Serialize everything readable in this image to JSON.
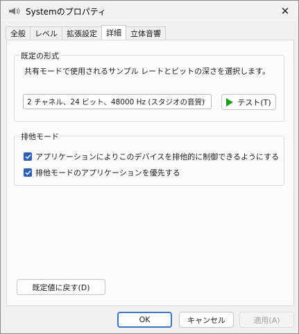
{
  "window": {
    "title": "Systemのプロパティ"
  },
  "tabs": [
    {
      "label": "全般"
    },
    {
      "label": "レベル"
    },
    {
      "label": "拡張設定"
    },
    {
      "label": "詳細"
    },
    {
      "label": "立体音響"
    }
  ],
  "default_format": {
    "group_label": "既定の形式",
    "description": "共有モードで使用されるサンプル レートとビットの深さを選択します。",
    "selected_format": "2 チャネル、24 ビット、48000 Hz (スタジオの音質)",
    "test_button": "テスト(T)"
  },
  "exclusive_mode": {
    "group_label": "排他モード",
    "options": [
      {
        "label": "アプリケーションによりこのデバイスを排他的に制御できるようにする",
        "checked": true
      },
      {
        "label": "排他モードのアプリケーションを優先する",
        "checked": true
      }
    ]
  },
  "restore_defaults_button": "既定値に戻す(D)",
  "footer": {
    "ok": "OK",
    "cancel": "キャンセル",
    "apply": "適用(A)"
  }
}
